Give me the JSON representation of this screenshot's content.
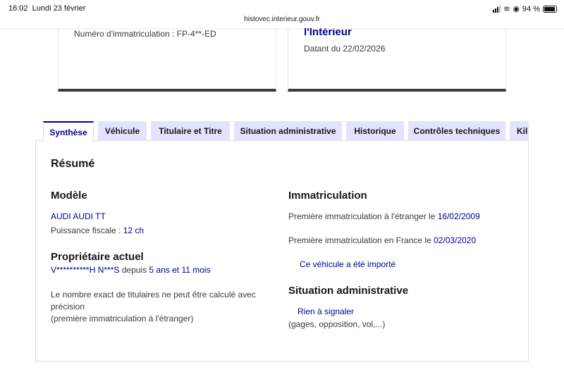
{
  "status": {
    "time": "16:02",
    "date": "Lundi 23 février",
    "battery": "94 %",
    "battery_level": 0.94,
    "url": "histovec.interieur.gouv.fr"
  },
  "cards": {
    "plate": "Numéro d'immatriculation : FP-4**-ED",
    "org": "l'Intérieur",
    "date": "Datant du 22/02/2026"
  },
  "tabs": [
    "Synthèse",
    "Véhicule",
    "Titulaire et Titre",
    "Situation administrative",
    "Historique",
    "Contrôles techniques",
    "Kil"
  ],
  "summary": {
    "title": "Résumé",
    "model_heading": "Modèle",
    "model": "AUDI AUDI TT",
    "power_label": "Puissance fiscale : ",
    "power": "12 ch",
    "owner_heading": "Propriétaire actuel",
    "owner": "V**********H N***S",
    "since_label": " depuis ",
    "since": "5 ans et 11 mois",
    "titulaires_note": "Le nombre exact de titulaires ne peut être calculé avec précision",
    "titulaires_note2": "(première immatriculation à l'étranger)",
    "immat_heading": "Immatriculation",
    "first_foreign_label": "Première immatriculation à l'étranger le ",
    "first_foreign": "16/02/2009",
    "first_fr_label": "Première immatriculation en France le ",
    "first_fr": "02/03/2020",
    "imported": "Ce véhicule a été importé",
    "admin_heading": "Situation administrative",
    "admin_status": "Rien à signaler",
    "admin_note": "(gages, opposition, vol,...)"
  }
}
